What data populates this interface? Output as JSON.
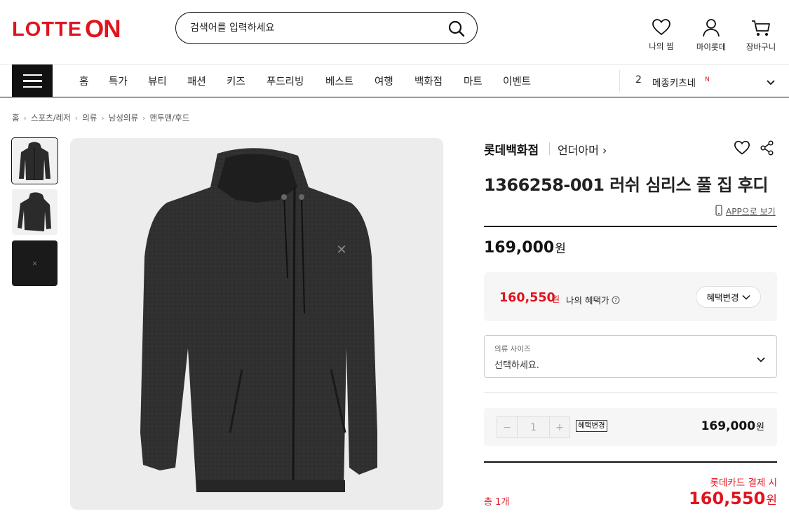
{
  "header": {
    "logo_left": "LOTTE",
    "logo_right": "ON",
    "search_placeholder": "검색어를 입력하세요",
    "icons": {
      "wish": {
        "icon": "heart-icon",
        "label": "나의 찜"
      },
      "mypage": {
        "icon": "user-icon",
        "label": "마이롯데"
      },
      "cart": {
        "icon": "cart-icon",
        "label": "장바구니"
      }
    }
  },
  "nav": {
    "items": [
      "홈",
      "특가",
      "뷰티",
      "패션",
      "키즈",
      "푸드리빙",
      "베스트",
      "여행",
      "백화점",
      "마트",
      "이벤트"
    ],
    "ranking": {
      "number": "2",
      "keyword": "메종키츠네",
      "badge": "N"
    }
  },
  "breadcrumb": [
    "홈",
    "스포츠/레저",
    "의류",
    "남성의류",
    "맨투맨/후드"
  ],
  "product": {
    "brand": "롯데백화점",
    "sub_brand": "언더아머 ›",
    "title": "1366258-001 러쉬 심리스 풀 집 후디",
    "app_link": "APP으로 보기",
    "price": "169,000",
    "price_unit": "원",
    "benefit": {
      "price": "160,550",
      "unit": "원",
      "label": "나의 혜택가",
      "button": "혜택변경"
    },
    "size_option": {
      "label": "의류 사이즈",
      "value": "선택하세요."
    },
    "quantity": {
      "minus": "−",
      "value": "1",
      "plus": "+",
      "badge": "혜택변경",
      "price": "169,000",
      "unit": "원"
    },
    "total": {
      "count": "총 1개",
      "card_label": "롯데카드 결제 시",
      "price": "160,550",
      "unit": "원"
    }
  },
  "colors": {
    "brand_red": "#e0141f",
    "dark": "#111111",
    "panel": "#f6f6f6"
  }
}
